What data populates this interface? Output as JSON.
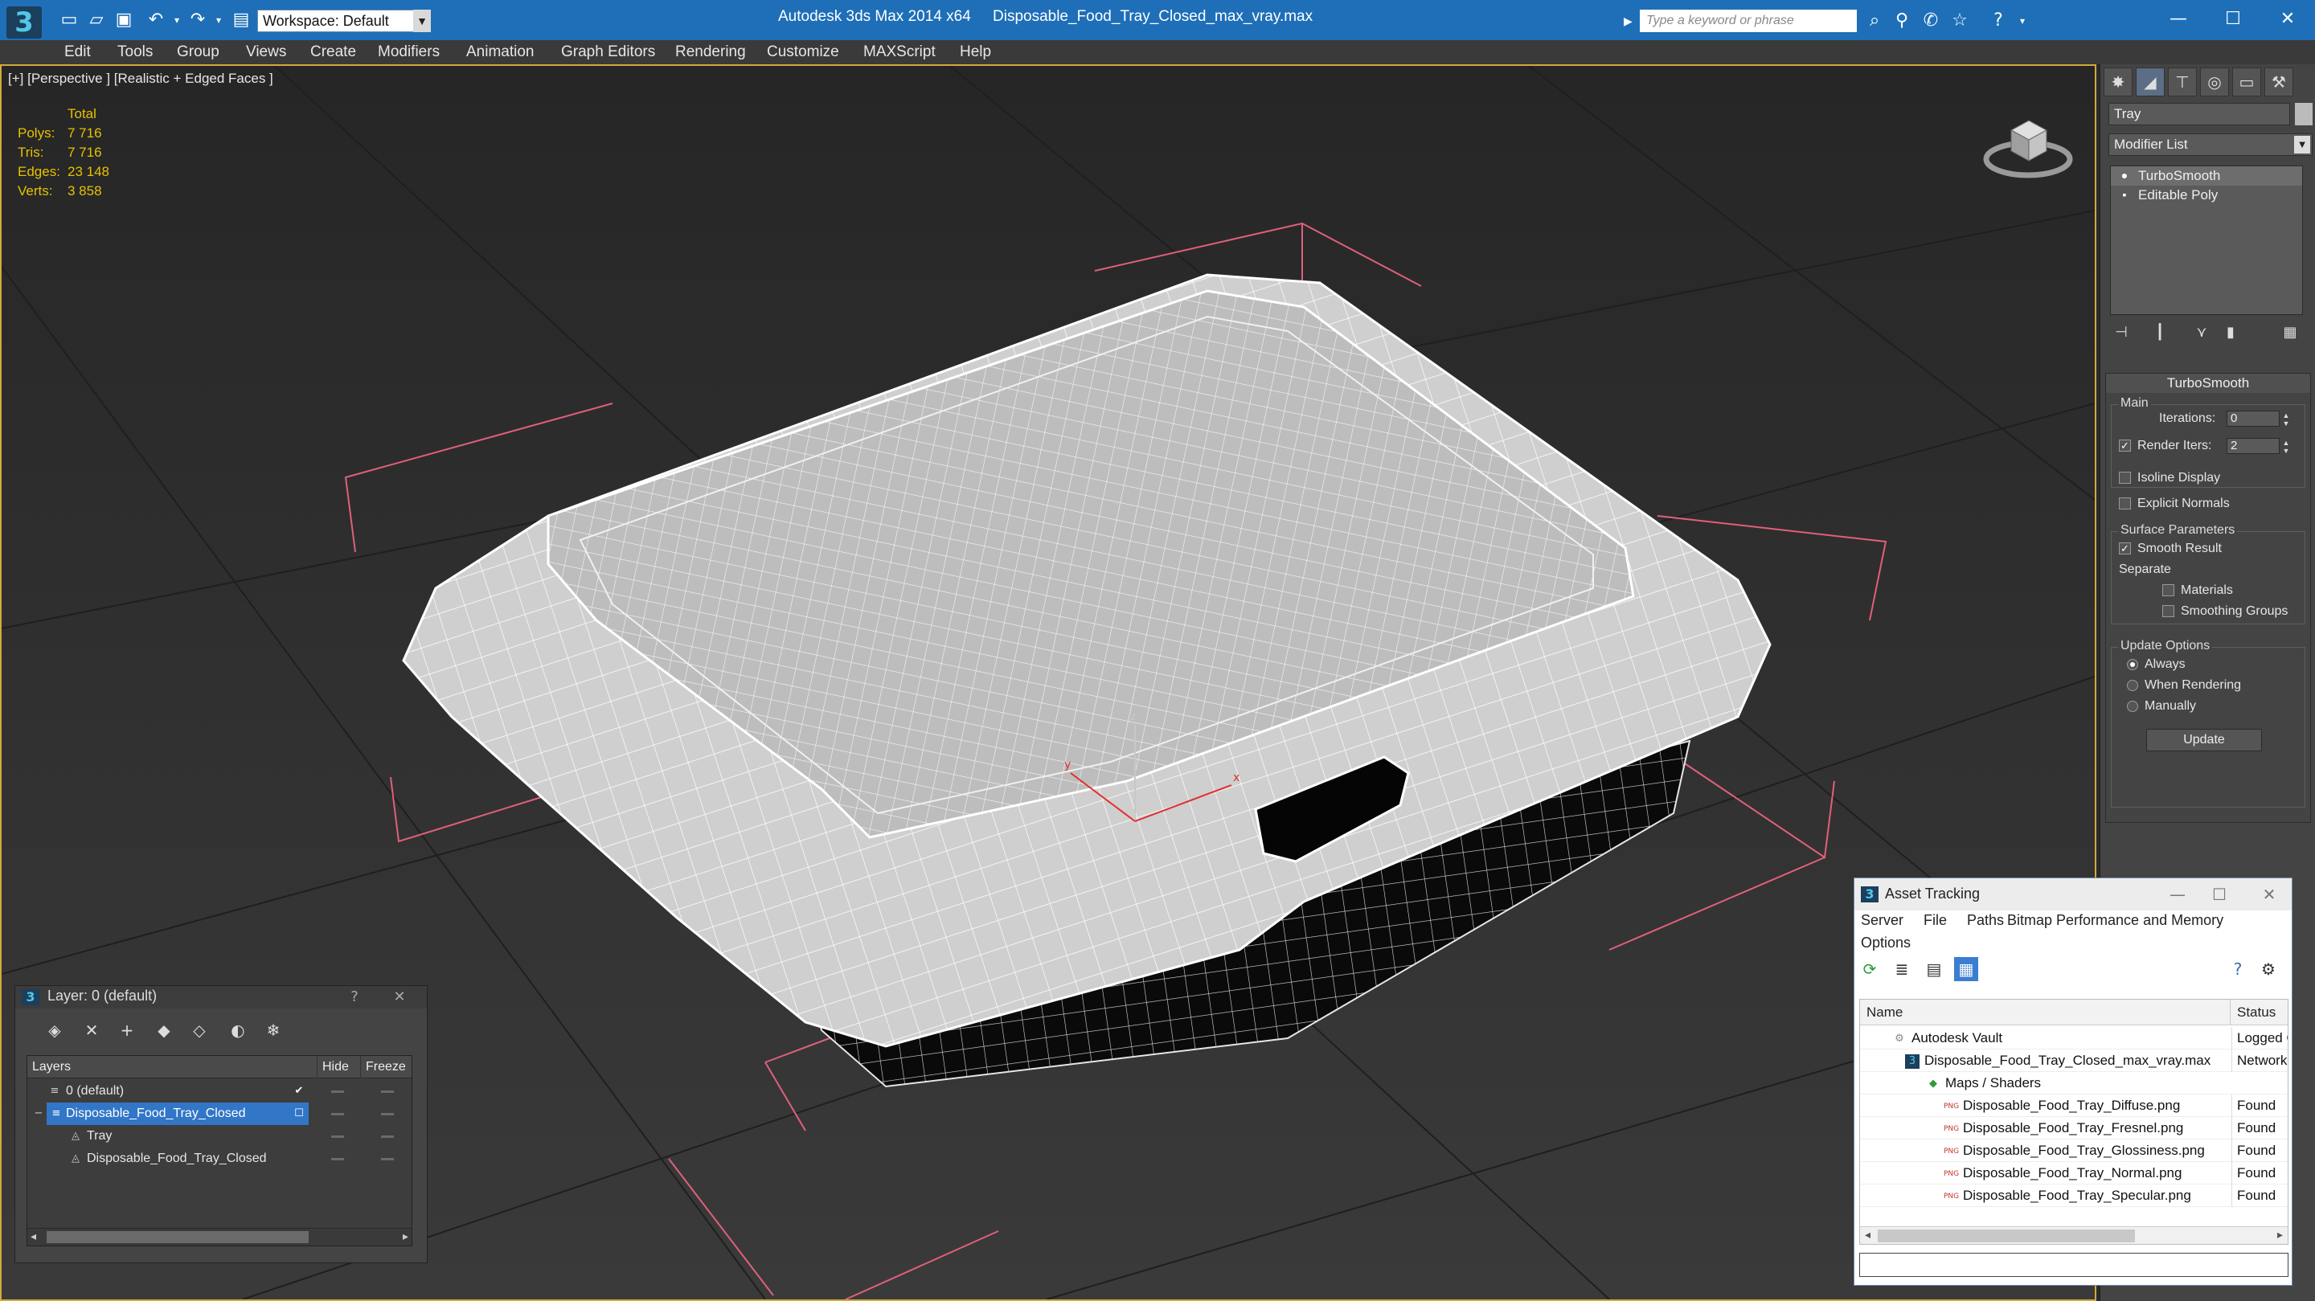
{
  "titlebar": {
    "app_title": "Autodesk 3ds Max  2014 x64",
    "file_title": "Disposable_Food_Tray_Closed_max_vray.max",
    "workspace": "Workspace: Default",
    "search_placeholder": "Type a keyword or phrase"
  },
  "menu": [
    "Edit",
    "Tools",
    "Group",
    "Views",
    "Create",
    "Modifiers",
    "Animation",
    "Graph Editors",
    "Rendering",
    "Customize",
    "MAXScript",
    "Help"
  ],
  "viewport": {
    "label": "[+] [Perspective ] [Realistic + Edged Faces ]",
    "stats": {
      "total_label": "Total",
      "rows": [
        {
          "label": "Polys:",
          "value": "7 716"
        },
        {
          "label": "Tris:",
          "value": "7 716"
        },
        {
          "label": "Edges:",
          "value": "23 148"
        },
        {
          "label": "Verts:",
          "value": "3 858"
        }
      ]
    }
  },
  "command_panel": {
    "object_name": "Tray",
    "modifier_list": "Modifier List",
    "stack": [
      "TurboSmooth",
      "Editable Poly"
    ],
    "turbosmooth": {
      "header": "TurboSmooth",
      "main_label": "Main",
      "iterations_label": "Iterations:",
      "iterations_value": "0",
      "render_iters_label": "Render Iters:",
      "render_iters_value": "2",
      "render_iters_checked": true,
      "isoline_label": "Isoline Display",
      "explicit_normals_label": "Explicit Normals",
      "surface_params_label": "Surface Parameters",
      "smooth_result_label": "Smooth Result",
      "separate_label": "Separate",
      "materials_label": "Materials",
      "smoothing_groups_label": "Smoothing Groups",
      "update_options_label": "Update Options",
      "always_label": "Always",
      "when_rendering_label": "When Rendering",
      "manually_label": "Manually",
      "update_button": "Update"
    }
  },
  "layer_window": {
    "title": "Layer: 0 (default)",
    "help": "?",
    "columns": [
      "Layers",
      "Hide",
      "Freeze"
    ],
    "rows": [
      {
        "name": "0 (default)"
      },
      {
        "name": "Disposable_Food_Tray_Closed"
      },
      {
        "name": "Tray"
      },
      {
        "name": "Disposable_Food_Tray_Closed"
      }
    ]
  },
  "asset_window": {
    "title": "Asset Tracking",
    "menu": [
      "Server",
      "File",
      "Paths",
      "Bitmap Performance and Memory",
      "Options"
    ],
    "columns": [
      "Name",
      "Status"
    ],
    "rows": [
      {
        "name": "Autodesk Vault",
        "status": "Logged Out"
      },
      {
        "name": "Disposable_Food_Tray_Closed_max_vray.max",
        "status": "Network"
      },
      {
        "name": "Maps / Shaders",
        "status": ""
      },
      {
        "name": "Disposable_Food_Tray_Diffuse.png",
        "status": "Found"
      },
      {
        "name": "Disposable_Food_Tray_Fresnel.png",
        "status": "Found"
      },
      {
        "name": "Disposable_Food_Tray_Glossiness.png",
        "status": "Found"
      },
      {
        "name": "Disposable_Food_Tray_Normal.png",
        "status": "Found"
      },
      {
        "name": "Disposable_Food_Tray_Specular.png",
        "status": "Found"
      }
    ]
  },
  "colors": {
    "titlebar": "#1e6fb8",
    "viewport_border": "#d4a93a",
    "stats_text": "#e6c200",
    "selection": "#3276c7"
  }
}
